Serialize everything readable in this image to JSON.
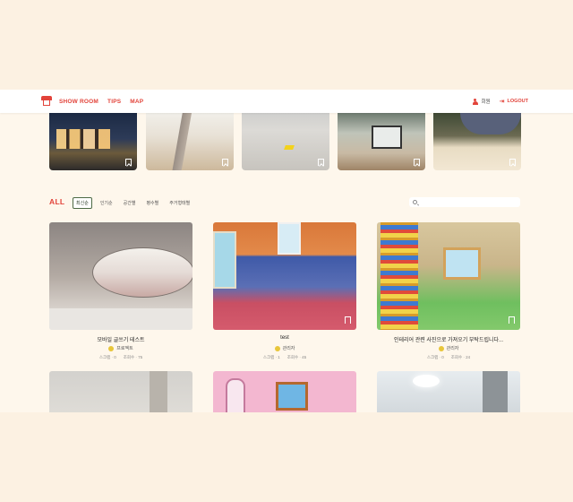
{
  "navbar": {
    "links": [
      "SHOW ROOM",
      "TIPS",
      "MAP"
    ],
    "user_label": "회원",
    "logout_label": "LOGOUT"
  },
  "filter": {
    "all_label": "ALL",
    "sort_tabs": [
      "최신순",
      "인기순",
      "공간별",
      "평수별",
      "주거형태별"
    ],
    "active_tab": "최신순",
    "search_placeholder": ""
  },
  "cards": [
    {
      "title": "모바일 글쓰기 테스트",
      "author": "프로젝트",
      "likes": "0",
      "views": "75"
    },
    {
      "title": "test",
      "author": "관리자",
      "likes": "1",
      "views": "45"
    },
    {
      "title": "인테리어 관련 사진으로 가져오기 부탁드립니다...",
      "author": "관리자",
      "likes": "0",
      "views": "24"
    }
  ],
  "stat_labels": {
    "likes": "스크랩",
    "views": "조회수"
  },
  "colors": {
    "accent": "#e2433a",
    "background": "#fcf1e2",
    "active_tab_border": "#4d6a45"
  }
}
